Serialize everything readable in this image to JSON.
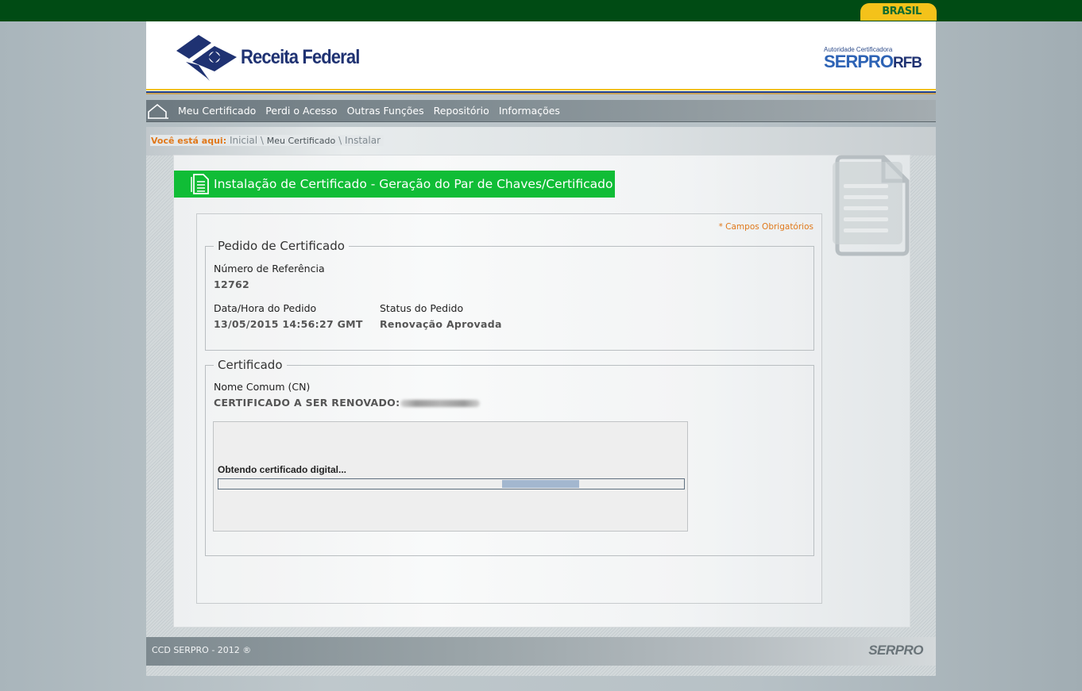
{
  "gov_bar": {
    "brasil_label": "BRASIL"
  },
  "header": {
    "logo_text": "Receita Federal",
    "ac_label": "Autoridade Certificadora",
    "ac_brand": "SERPRO",
    "ac_brand_suffix": "RFB"
  },
  "nav": {
    "items": [
      "Meu Certificado",
      "Perdi o Acesso",
      "Outras Funções",
      "Repositório",
      "Informações"
    ]
  },
  "breadcrumb": {
    "label": "Você está aqui:",
    "items": [
      "Inicial",
      "Meu Certificado",
      "Instalar"
    ],
    "separator": "\\"
  },
  "page": {
    "title": "Instalação de Certificado - Geração do Par de Chaves/Certificado",
    "required_note": "* Campos Obrigatórios"
  },
  "pedido": {
    "legend": "Pedido de Certificado",
    "ref_label": "Número de Referência",
    "ref_value": "12762",
    "date_label": "Data/Hora do Pedido",
    "date_value": "13/05/2015 14:56:27 GMT",
    "status_label": "Status do Pedido",
    "status_value": "Renovação Aprovada"
  },
  "certificado": {
    "legend": "Certificado",
    "cn_label": "Nome Comum (CN)",
    "cn_value": "CERTIFICADO A SER RENOVADO:"
  },
  "applet": {
    "status_text": "Obtendo certificado digital...",
    "progress_fill_start": 0.61,
    "progress_fill_end": 0.775
  },
  "footer": {
    "copyright": "CCD SERPRO - 2012 ®",
    "logo": "SERPRO"
  },
  "colors": {
    "gov_green": "#004b14",
    "title_green": "#10bd36",
    "accent_orange": "#e0781a",
    "brand_blue": "#1f3272"
  }
}
